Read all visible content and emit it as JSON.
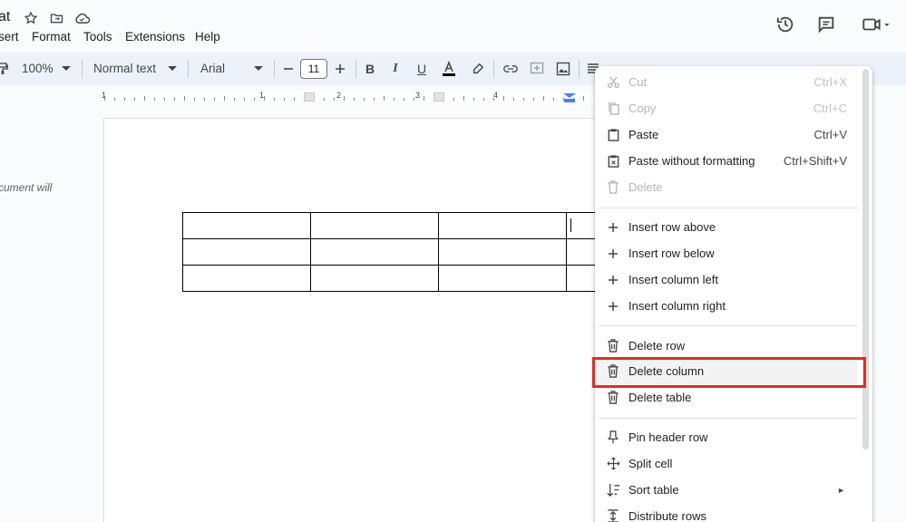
{
  "title": {
    "fragment": "at"
  },
  "menu": [
    "sert",
    "Format",
    "Tools",
    "Extensions",
    "Help"
  ],
  "toolbar": {
    "zoom": "100%",
    "style": "Normal text",
    "font": "Arial",
    "font_size": "11",
    "minus": "—",
    "plus": "+"
  },
  "ruler": {
    "numbers": [
      "1",
      "1",
      "2",
      "3",
      "4"
    ]
  },
  "document": {
    "side_note": "cument will",
    "table": {
      "rows": 3,
      "cols": 4
    }
  },
  "context_menu": {
    "items": [
      {
        "label": "Cut",
        "shortcut": "Ctrl+X",
        "icon": "scissors-icon",
        "disabled": true
      },
      {
        "label": "Copy",
        "shortcut": "Ctrl+C",
        "icon": "copy-icon",
        "disabled": true
      },
      {
        "label": "Paste",
        "shortcut": "Ctrl+V",
        "icon": "paste-icon",
        "disabled": false
      },
      {
        "label": "Paste without formatting",
        "shortcut": "Ctrl+Shift+V",
        "icon": "paste-plain-icon",
        "disabled": false
      },
      {
        "label": "Delete",
        "shortcut": "",
        "icon": "trash-icon",
        "disabled": true
      },
      {
        "label": "Insert row above",
        "shortcut": "",
        "icon": "plus-icon",
        "disabled": false
      },
      {
        "label": "Insert row below",
        "shortcut": "",
        "icon": "plus-icon",
        "disabled": false
      },
      {
        "label": "Insert column left",
        "shortcut": "",
        "icon": "plus-icon",
        "disabled": false
      },
      {
        "label": "Insert column right",
        "shortcut": "",
        "icon": "plus-icon",
        "disabled": false
      },
      {
        "label": "Delete row",
        "shortcut": "",
        "icon": "trash-icon",
        "disabled": false
      },
      {
        "label": "Delete column",
        "shortcut": "",
        "icon": "trash-icon",
        "disabled": false,
        "highlighted": true
      },
      {
        "label": "Delete table",
        "shortcut": "",
        "icon": "trash-icon",
        "disabled": false
      },
      {
        "label": "Pin header row",
        "shortcut": "",
        "icon": "pin-icon",
        "disabled": false
      },
      {
        "label": "Split cell",
        "shortcut": "",
        "icon": "split-icon",
        "disabled": false
      },
      {
        "label": "Sort table",
        "shortcut": "",
        "icon": "sort-icon",
        "disabled": false,
        "submenu_arrow": "►"
      },
      {
        "label": "Distribute rows",
        "shortcut": "",
        "icon": "distribute-icon",
        "disabled": false
      }
    ]
  },
  "colors": {
    "highlight_border": "#d93025",
    "toolbar_bg": "#edf2fa"
  }
}
